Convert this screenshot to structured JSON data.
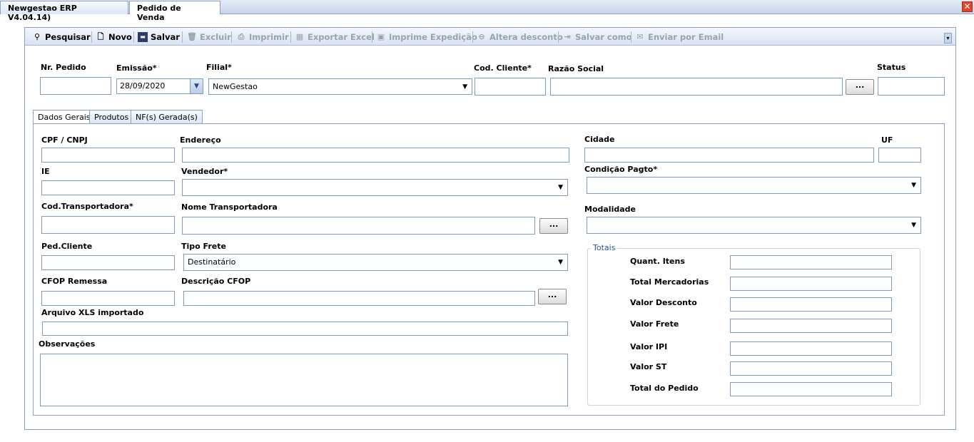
{
  "window": {
    "tabs": [
      "Newgestao ERP V4.04.14)",
      "Pedido de Venda"
    ],
    "close_icon": "close-icon"
  },
  "toolbar": {
    "pesquisar": "Pesquisar",
    "novo": "Novo",
    "salvar": "Salvar",
    "excluir": "Excluir",
    "imprimir": "Imprimir",
    "exportar_excel": "Exportar Excel",
    "imprime_expedicao": "Imprime Expedição",
    "altera_desconto": "Altera desconto",
    "salvar_como": "Salvar como",
    "enviar_email": "Enviar por Email"
  },
  "header": {
    "nr_pedido": {
      "label": "Nr. Pedido",
      "value": ""
    },
    "emissao": {
      "label": "Emissão*",
      "value": "28/09/2020"
    },
    "filial": {
      "label": "Filial*",
      "value": "NewGestao"
    },
    "cod_cliente": {
      "label": "Cod. Cliente*",
      "value": ""
    },
    "razao_social": {
      "label": "Razão Social",
      "value": "",
      "button": "..."
    },
    "status": {
      "label": "Status",
      "value": ""
    }
  },
  "inner_tabs": [
    "Dados Gerais",
    "Produtos",
    "NF(s) Gerada(s)"
  ],
  "form": {
    "cpf_cnpj": "CPF / CNPJ",
    "endereco": "Endereço",
    "cidade": "Cidade",
    "uf": "UF",
    "ie": "IE",
    "vendedor": "Vendedor*",
    "condicao_pagto": "Condição Pagto*",
    "cod_transportadora": "Cod.Transportadora*",
    "nome_transportadora": "Nome Transportadora",
    "modalidade": "Modalidade",
    "ped_cliente": "Ped.Cliente",
    "tipo_frete": "Tipo Frete",
    "tipo_frete_value": "Destinatário",
    "cfop_remessa": "CFOP Remessa",
    "descricao_cfop": "Descrição CFOP",
    "arquivo_xls": "Arquivo XLS importado",
    "observacoes": "Observações",
    "ellipsis": "..."
  },
  "totais": {
    "title": "Totais",
    "quant_itens": "Quant. Itens",
    "total_mercadorias": "Total Mercadorias",
    "valor_desconto": "Valor Desconto",
    "valor_frete": "Valor Frete",
    "valor_ipi": "Valor IPI",
    "valor_st": "Valor ST",
    "total_pedido": "Total do Pedido"
  },
  "colors": {
    "accent": "#2a55a5",
    "border": "#7f9db9",
    "toolbar_bg": "#d9e3f1"
  }
}
